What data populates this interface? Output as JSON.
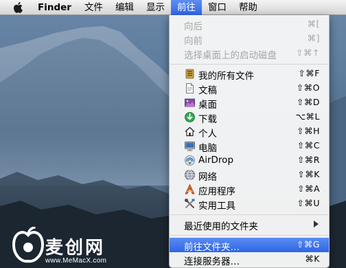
{
  "menubar": {
    "apple_icon": "apple-logo-icon",
    "items": [
      {
        "label": "Finder"
      },
      {
        "label": "文件"
      },
      {
        "label": "编辑"
      },
      {
        "label": "显示"
      },
      {
        "label": "前往"
      },
      {
        "label": "窗口"
      },
      {
        "label": "帮助"
      }
    ]
  },
  "go_menu": {
    "items": [
      {
        "label": "向后",
        "shortcut": "⌘[",
        "enabled": false
      },
      {
        "label": "向前",
        "shortcut": "⌘]",
        "enabled": false
      },
      {
        "label": "选择桌面上的启动磁盘",
        "shortcut": "⇧⌘↑",
        "enabled": false
      },
      {
        "label": "我的所有文件",
        "shortcut": "⇧⌘F",
        "icon": "all-my-files-icon"
      },
      {
        "label": "文稿",
        "shortcut": "⇧⌘O",
        "icon": "documents-icon"
      },
      {
        "label": "桌面",
        "shortcut": "⇧⌘D",
        "icon": "desktop-icon"
      },
      {
        "label": "下载",
        "shortcut": "⌥⌘L",
        "icon": "downloads-icon"
      },
      {
        "label": "个人",
        "shortcut": "⇧⌘H",
        "icon": "home-icon"
      },
      {
        "label": "电脑",
        "shortcut": "⇧⌘C",
        "icon": "computer-icon"
      },
      {
        "label": "AirDrop",
        "shortcut": "⇧⌘R",
        "icon": "airdrop-icon"
      },
      {
        "label": "网络",
        "shortcut": "⇧⌘K",
        "icon": "network-icon"
      },
      {
        "label": "应用程序",
        "shortcut": "⇧⌘A",
        "icon": "applications-icon"
      },
      {
        "label": "实用工具",
        "shortcut": "⇧⌘U",
        "icon": "utilities-icon"
      },
      {
        "label": "最近使用的文件夹",
        "submenu": true
      },
      {
        "label": "前往文件夹…",
        "shortcut": "⇧⌘G",
        "highlighted": true
      },
      {
        "label": "连接服务器…",
        "shortcut": "⌘K"
      }
    ]
  },
  "watermark": {
    "text": "麦创网",
    "url": "www.MeMacX.com"
  }
}
